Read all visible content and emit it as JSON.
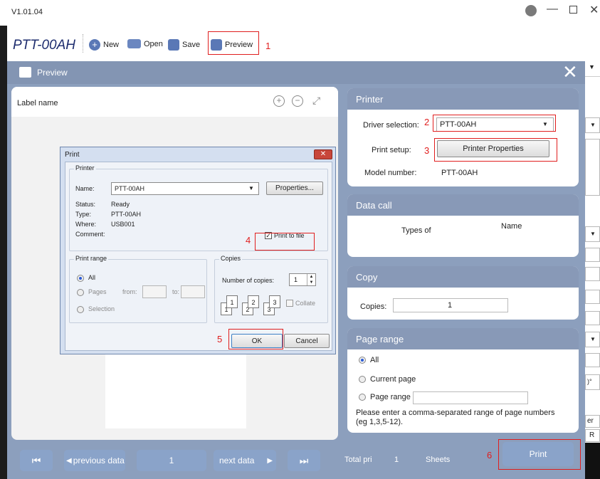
{
  "app": {
    "version": "V1.01.04",
    "name": "PTT-00AH"
  },
  "toolbar": {
    "new_label": "New",
    "open_label": "Open",
    "save_label": "Save",
    "preview_label": "Preview"
  },
  "preview": {
    "title": "Preview",
    "label_name": "Label name",
    "printer_section": {
      "header": "Printer",
      "driver_label": "Driver selection:",
      "driver_value": "PTT-00AH",
      "setup_label": "Print setup:",
      "properties_button": "Printer Properties",
      "model_label": "Model number:",
      "model_value": "PTT-00AH"
    },
    "data_call": {
      "header": "Data call",
      "col_types": "Types of",
      "col_name": "Name"
    },
    "copy": {
      "header": "Copy",
      "copies_label": "Copies:",
      "copies_value": "1"
    },
    "page_range": {
      "header": "Page range",
      "opt_all": "All",
      "opt_current": "Current page",
      "opt_range": "Page range",
      "hint": "Please enter a comma-separated range of page numbers (eg 1,3,5-12)."
    },
    "footer": {
      "previous_label": "previous data",
      "page_number": "1",
      "next_label": "next data",
      "total_label": "Total pri",
      "total_value": "1",
      "sheets_label": "Sheets",
      "print_button": "Print"
    }
  },
  "print_dialog": {
    "title": "Print",
    "printer_group": "Printer",
    "name_label": "Name:",
    "name_value": "PTT-00AH",
    "properties_button": "Properties...",
    "status_label": "Status:",
    "status_value": "Ready",
    "type_label": "Type:",
    "type_value": "PTT-00AH",
    "where_label": "Where:",
    "where_value": "USB001",
    "comment_label": "Comment:",
    "print_to_file": "Print to file",
    "range_group": "Print range",
    "range_all": "All",
    "range_pages": "Pages",
    "range_from": "from:",
    "range_to": "to:",
    "range_selection": "Selection",
    "copies_group": "Copies",
    "copies_label": "Number of copies:",
    "copies_value": "1",
    "collate_label": "Collate",
    "collate_nums": [
      "1",
      "1",
      "2",
      "2",
      "3",
      "3"
    ],
    "ok_button": "OK",
    "cancel_button": "Cancel"
  },
  "annotations": [
    "1",
    "2",
    "3",
    "4",
    "5",
    "6"
  ],
  "side_controls": {
    "r_label": "R",
    "er_label": "er",
    "deg_label": ")°"
  },
  "colors": {
    "header_blue": "#8395b3",
    "panel_blue": "#8899b7",
    "button_blue": "#8aa3c9",
    "annotation_red": "#e01e1e"
  }
}
